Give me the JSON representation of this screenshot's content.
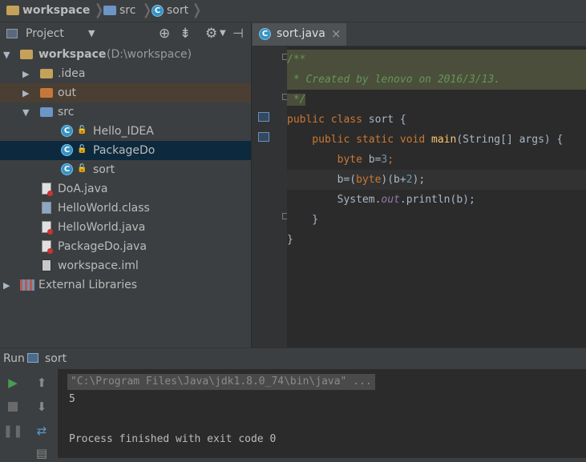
{
  "breadcrumb": {
    "root": "workspace",
    "folder": "src",
    "file": "sort"
  },
  "project_panel": {
    "title": "Project",
    "tree": {
      "root_label": "workspace",
      "root_path": "(D:\\workspace)",
      "items": {
        "idea": ".idea",
        "out": "out",
        "src": "src",
        "hello_idea": "Hello_IDEA",
        "packagedo": "PackageDo",
        "sort": "sort",
        "doa": "DoA.java",
        "helloworld_class": "HelloWorld.class",
        "helloworld_java": "HelloWorld.java",
        "packagedo_java": "PackageDo.java",
        "workspace_iml": "workspace.iml",
        "external_libraries": "External Libraries"
      }
    }
  },
  "editor": {
    "tab_label": "sort.java",
    "tab_close": "×",
    "code": {
      "l1": "/**",
      "l2": " * Created by lenovo on 2016/3/13.",
      "l3": " */",
      "l4_kw": "public class ",
      "l4_rest": "sort {",
      "l5_kw": "    public static void ",
      "l5_fn": "main",
      "l5_rest": "(String[] args) {",
      "l6_kw": "        byte ",
      "l6_rest": "b=",
      "l6_num": "3",
      "l6_end": ";",
      "l7_a": "        b=(",
      "l7_kw": "byte",
      "l7_b": ")(b+",
      "l7_num": "2",
      "l7_c": ");",
      "l8_a": "        System.",
      "l8_fld": "out",
      "l8_b": ".println(b);",
      "l9": "    }",
      "l10": "}"
    }
  },
  "run_panel": {
    "title": "Run",
    "config": "sort",
    "console": {
      "command": "\"C:\\Program Files\\Java\\jdk1.8.0_74\\bin\\java\" ...",
      "output": "5",
      "exit": "Process finished with exit code 0"
    }
  },
  "colors": {
    "keyword": "#cc7832",
    "comment": "#629755",
    "selection": "#0d293e",
    "run_green": "#499c54"
  }
}
